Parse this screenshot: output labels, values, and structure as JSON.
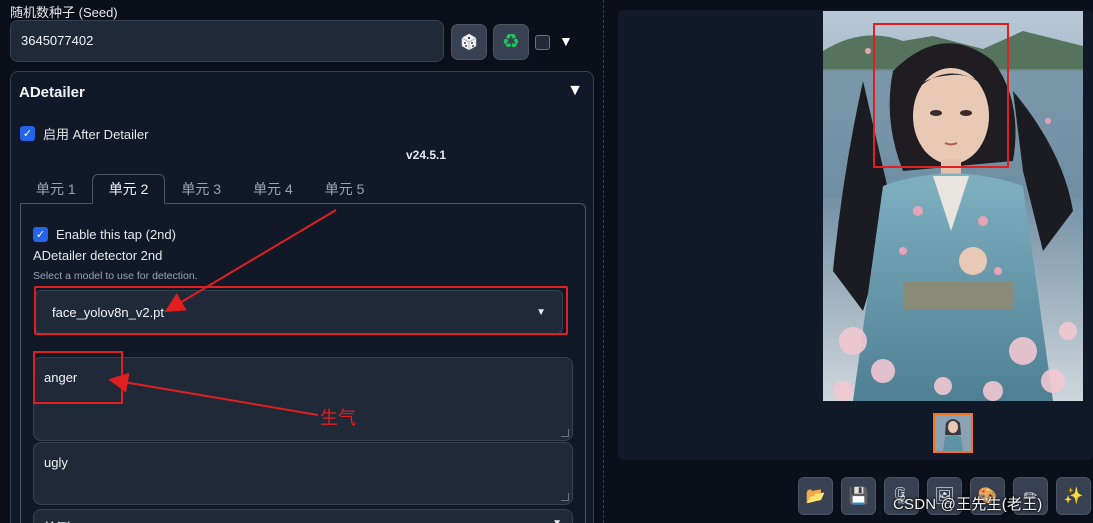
{
  "seed": {
    "label": "随机数种子 (Seed)",
    "value": "3645077402",
    "dice_icon": "dice-icon",
    "recycle_icon": "recycle-icon"
  },
  "adetailer": {
    "title": "ADetailer",
    "enable_label": "启用 After Detailer",
    "version": "v24.5.1",
    "tabs": [
      {
        "label": "单元 1"
      },
      {
        "label": "单元 2"
      },
      {
        "label": "单元 3"
      },
      {
        "label": "单元 4"
      },
      {
        "label": "单元 5"
      }
    ],
    "active_tab_index": 1,
    "enable_tap_label": "Enable this tap (2nd)",
    "detector_label": "ADetailer detector 2nd",
    "detector_hint": "Select a model to use for detection.",
    "model_value": "face_yolov8n_v2.pt",
    "prompt_value": "anger",
    "negative_prompt_value": "ugly",
    "bottom_row_label": "检测"
  },
  "annotation": {
    "text": "生气",
    "color": "#e02020"
  },
  "toolbar": {
    "icons": [
      "folder-icon",
      "save-icon",
      "archive-icon",
      "image-icon",
      "palette-icon",
      "pencil-icon",
      "sparkle-icon"
    ]
  },
  "watermark": "CSDN @王先生(老王)"
}
